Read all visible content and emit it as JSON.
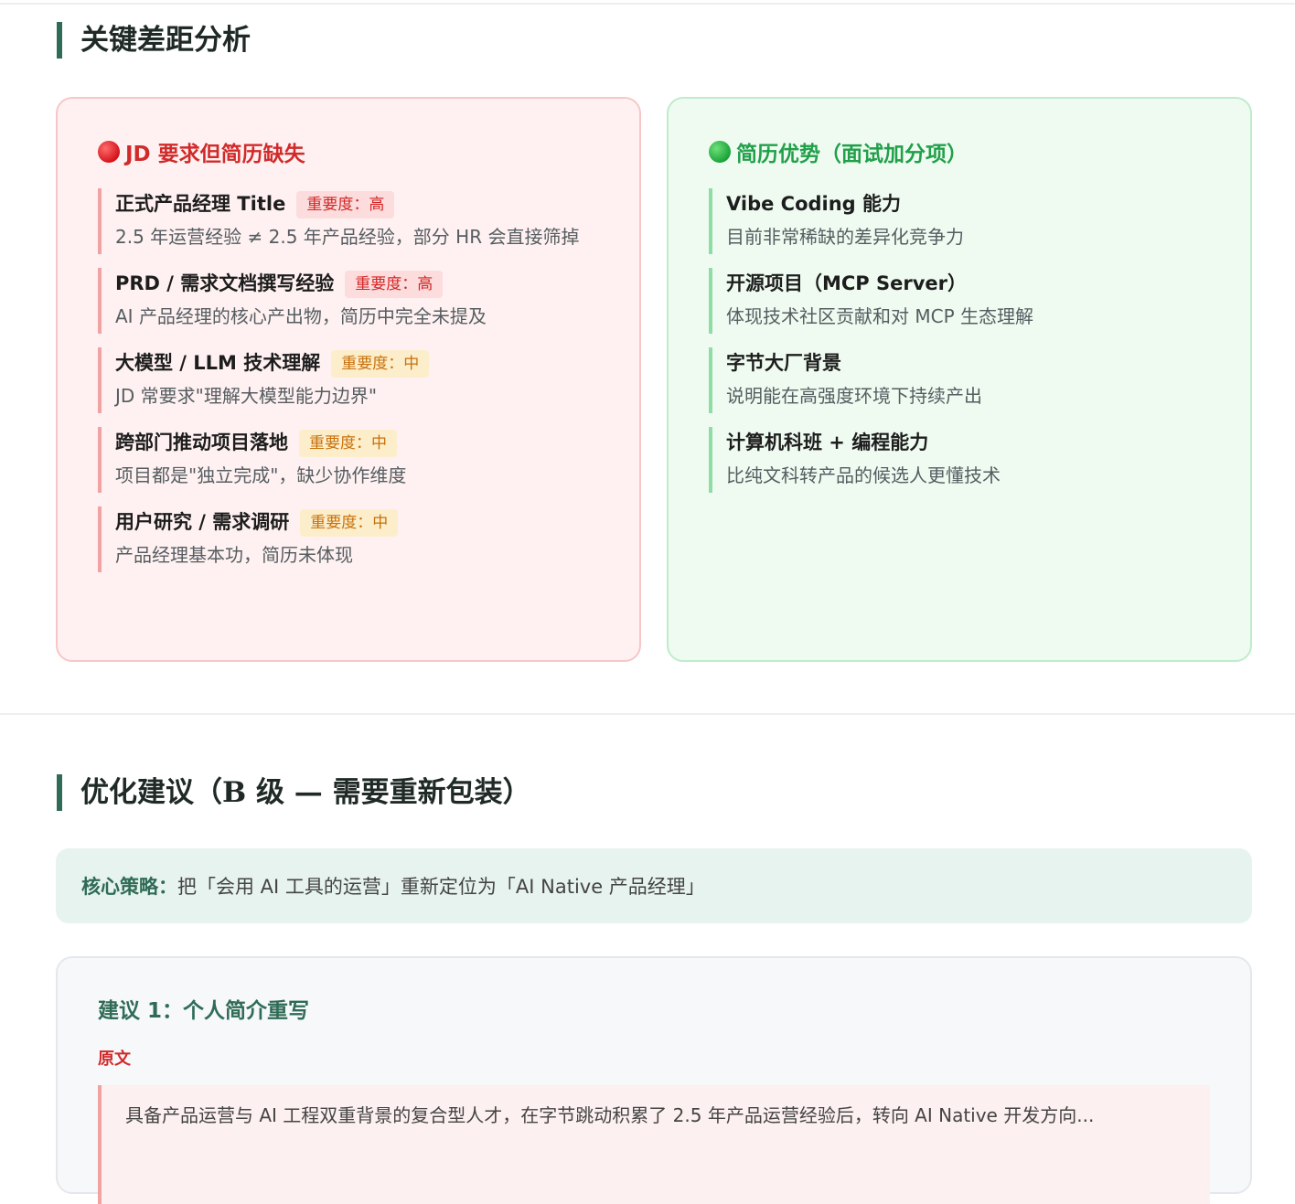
{
  "sections": {
    "gap_title": "关键差距分析",
    "optimize_title": "优化建议（B 级 — 需要重新包装）"
  },
  "gap_card": {
    "heading": "JD 要求但简历缺失",
    "icon": "red-circle",
    "items": [
      {
        "title": "正式产品经理 Title",
        "badge": "重要度：高",
        "level": "high",
        "desc": "2.5 年运营经验 ≠ 2.5 年产品经验，部分 HR 会直接筛掉"
      },
      {
        "title": "PRD / 需求文档撰写经验",
        "badge": "重要度：高",
        "level": "high",
        "desc": "AI 产品经理的核心产出物，简历中完全未提及"
      },
      {
        "title": "大模型 / LLM 技术理解",
        "badge": "重要度：中",
        "level": "mid",
        "desc": "JD 常要求\"理解大模型能力边界\""
      },
      {
        "title": "跨部门推动项目落地",
        "badge": "重要度：中",
        "level": "mid",
        "desc": "项目都是\"独立完成\"，缺少协作维度"
      },
      {
        "title": "用户研究 / 需求调研",
        "badge": "重要度：中",
        "level": "mid",
        "desc": "产品经理基本功，简历未体现"
      }
    ]
  },
  "advantage_card": {
    "heading": "简历优势（面试加分项）",
    "icon": "green-circle",
    "items": [
      {
        "title": "Vibe Coding 能力",
        "desc": "目前非常稀缺的差异化竞争力"
      },
      {
        "title": "开源项目（MCP Server）",
        "desc": "体现技术社区贡献和对 MCP 生态理解"
      },
      {
        "title": "字节大厂背景",
        "desc": "说明能在高强度环境下持续产出"
      },
      {
        "title": "计算机科班 + 编程能力",
        "desc": "比纯文科转产品的候选人更懂技术"
      }
    ]
  },
  "strategy": {
    "label": "核心策略：",
    "text": "把「会用 AI 工具的运营」重新定位为「AI Native 产品经理」"
  },
  "suggestion": {
    "title": "建议 1：个人简介重写",
    "original_label": "原文",
    "original_text": "具备产品运营与 AI 工程双重背景的复合型人才，在字节跳动积累了 2.5 年产品运营经验后，转向 AI Native 开发方向..."
  },
  "colors": {
    "accent": "#2f6b55",
    "danger": "#d12a2a",
    "success": "#21a04a",
    "badge_high": "#fcdcdc",
    "badge_mid": "#fdeecb"
  }
}
